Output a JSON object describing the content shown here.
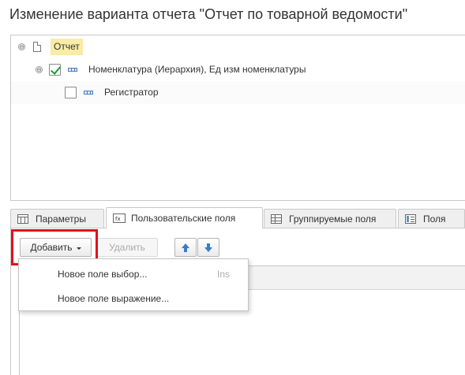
{
  "window": {
    "title": "Изменение варианта отчета \"Отчет по товарной ведомости\""
  },
  "tree": {
    "root": {
      "label": "Отчет",
      "expander": "⊖"
    },
    "items": [
      {
        "label": "Номенклатура (Иерархия), Ед изм номенклатуры",
        "checked": true,
        "expander": "⊖"
      },
      {
        "label": "Регистратор",
        "checked": false
      }
    ]
  },
  "tabs": [
    {
      "label": "Параметры",
      "icon": "parameters-icon"
    },
    {
      "label": "Пользовательские поля",
      "icon": "fx-icon",
      "active": true
    },
    {
      "label": "Группируемые поля",
      "icon": "grouping-icon"
    },
    {
      "label": "Поля",
      "icon": "fields-icon"
    }
  ],
  "toolbar": {
    "add_label": "Добавить",
    "delete_label": "Удалить"
  },
  "menu": {
    "items": [
      {
        "label": "Новое поле выбор...",
        "shortcut": "Ins"
      },
      {
        "label": "Новое поле выражение..."
      }
    ]
  },
  "colors": {
    "highlight": "#f8eca6",
    "callout": "#e0101a",
    "check": "#1a9a3a",
    "arrows": "#3a7cc9"
  }
}
